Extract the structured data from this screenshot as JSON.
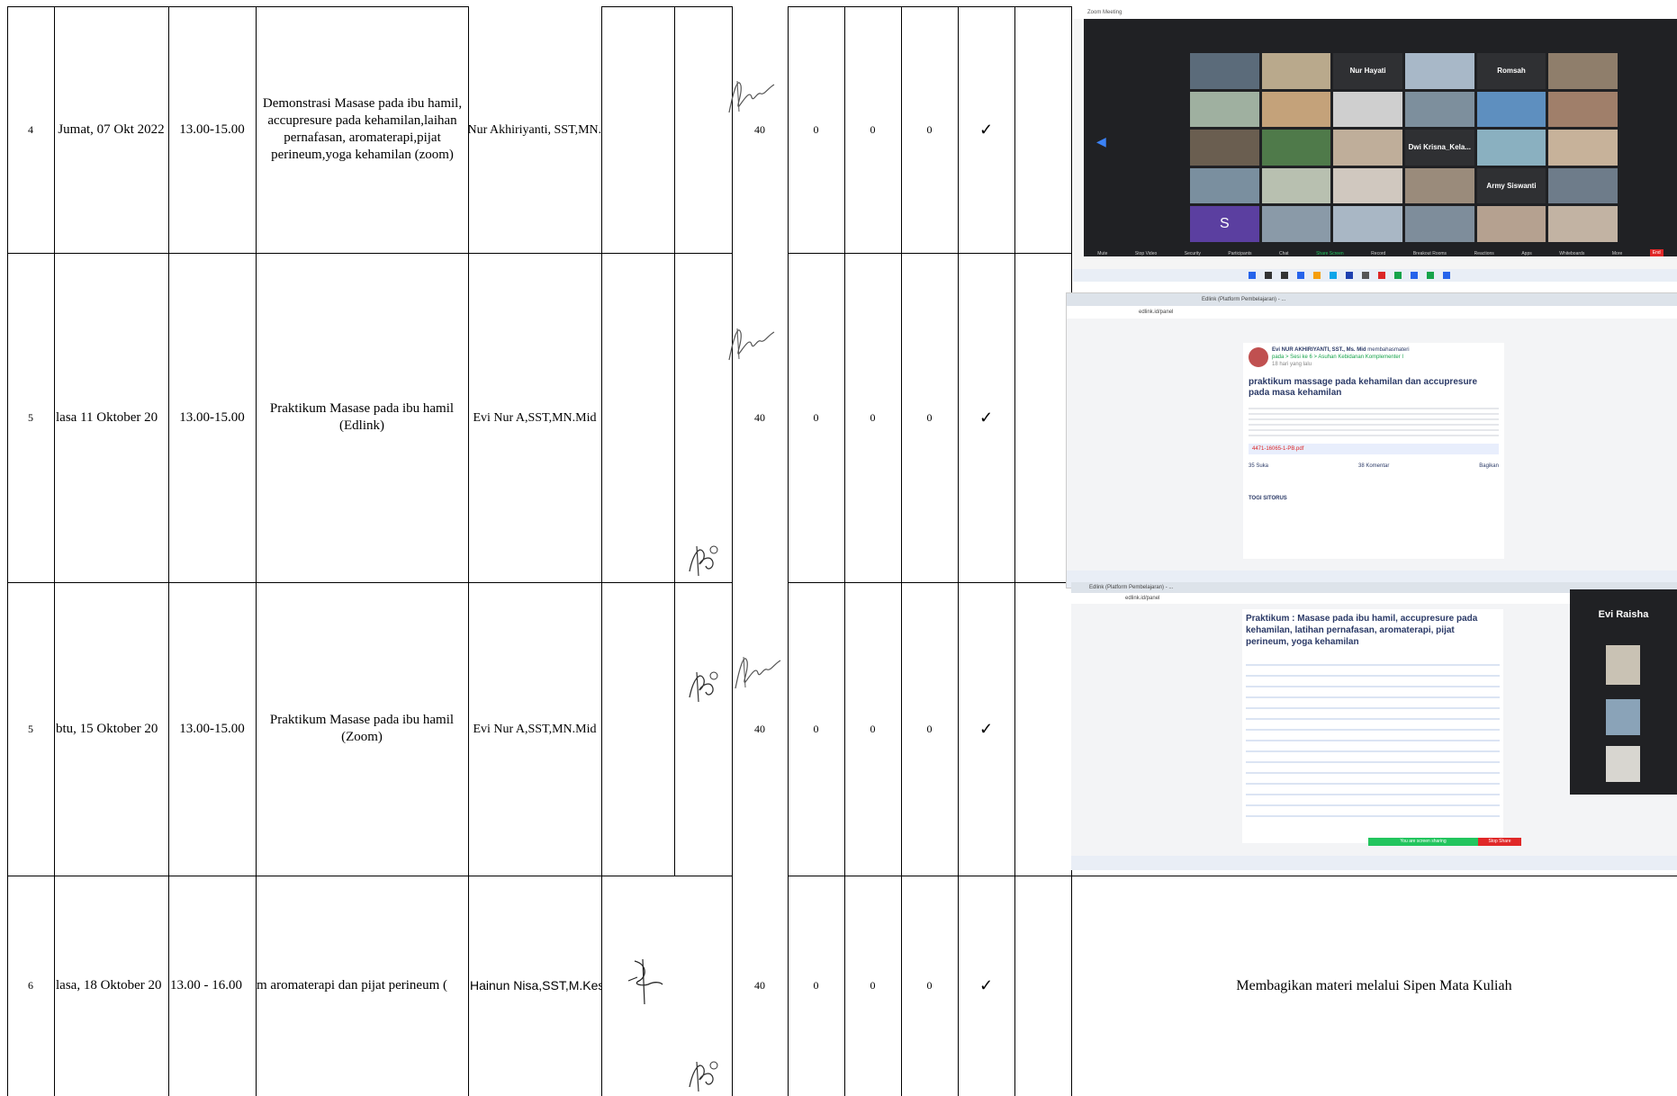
{
  "rows": [
    {
      "no": "4",
      "date": "Jumat, 07 Okt 2022",
      "time": "13.00-15.00",
      "topic": "Demonstrasi Masase pada ibu hamil, accupresure pada kehamilan,laihan pernafasan, aromaterapi,pijat perineum,yoga kehamilan (zoom)",
      "lecturer": "Evi Nur Akhiriyanti, SST,MN.Mid",
      "participants": "40",
      "c1": "0",
      "c2": "0",
      "c3": "0",
      "check": "✓"
    },
    {
      "no": "5",
      "date": "lasa 11 Oktober 20",
      "time": "13.00-15.00",
      "topic": "Praktikum Masase pada ibu hamil (Edlink)",
      "lecturer": "Evi Nur A,SST,MN.Mid",
      "participants": "40",
      "c1": "0",
      "c2": "0",
      "c3": "0",
      "check": "✓"
    },
    {
      "no": "5",
      "date": "btu, 15 Oktober 20",
      "time": "13.00-15.00",
      "topic": "Praktikum Masase pada ibu hamil (Zoom)",
      "lecturer": "Evi Nur A,SST,MN.Mid",
      "participants": "40",
      "c1": "0",
      "c2": "0",
      "c3": "0",
      "check": "✓"
    },
    {
      "no": "6",
      "date": "lasa, 18 Oktober 20",
      "time": "13.00 - 16.00",
      "topic": "m aromaterapi dan pijat perineum (",
      "lecturer": "Hainun Nisa,SST,M.Kes",
      "participants": "40",
      "c1": "0",
      "c2": "0",
      "c3": "0",
      "check": "✓",
      "evidence": "Membagikan materi melalui Sipen Mata Kuliah"
    }
  ],
  "zoom_shot": {
    "window_title": "Zoom Meeting",
    "names": [
      "Nur Hayati",
      "Romsah",
      "Dwi Krisna_Kela...",
      "Army Siswanti"
    ],
    "avatar_letter": "S",
    "toolbar": [
      "Mute",
      "Stop Video",
      "Security",
      "Participants",
      "Chat",
      "Share Screen",
      "Record",
      "Breakout Rooms",
      "Reactions",
      "Apps",
      "Whiteboards",
      "More"
    ],
    "end_label": "End"
  },
  "edlink_shot": {
    "tab_title": "Edlink (Platform Pembelajaran) - ...",
    "url": "edlink.id/panel",
    "poster": "Evi NUR AKHIRIYANTI, SST., Ms. Mid",
    "poster_action": "membahasmateri",
    "breadcrumb": "pada > Sesi ke 6 > Asuhan Kebidanan Komplementer I",
    "time_ago": "18 hari yang lalu",
    "post_title": "praktikum massage pada kehamilan dan accupresure pada masa kehamilan",
    "file_name": "4471-16065-1-PB.pdf",
    "likes": "35 Suka",
    "comments": "38 Komentar",
    "share": "Bagikan",
    "commenter": "TOGI SITORUS"
  },
  "edlink_shot2": {
    "tab_title": "Edlink (Platform Pembelajaran) - ...",
    "url": "edlink.id/panel",
    "post_title": "Praktikum : Masase pada ibu hamil, accupresure pada kehamilan, latihan pernafasan, aromaterapi, pijat perineum, yoga kehamilan",
    "side_name": "Evi Raisha",
    "sharing_banner": "You are screen sharing",
    "stop_share": "Stop Share"
  },
  "colors": {
    "zoom_bg": "#202124",
    "zoom_tile": "#2f3033",
    "edlink_blue": "#2b3a67",
    "taskbar": "#e9eef6",
    "end_red": "#e02828"
  }
}
